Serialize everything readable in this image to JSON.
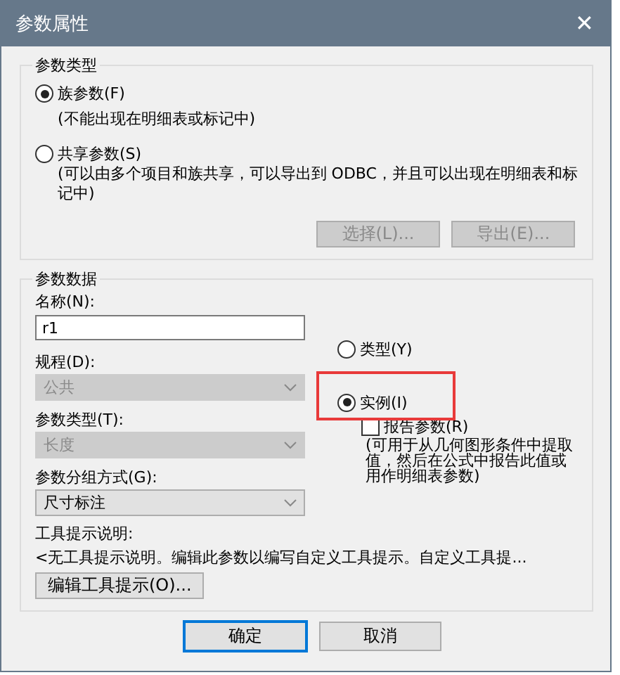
{
  "window": {
    "title": "参数属性",
    "close": "✕"
  },
  "parameter_type": {
    "legend": "参数类型",
    "options": [
      {
        "label": "族参数(F)",
        "note": "(不能出现在明细表或标记中)",
        "selected": true
      },
      {
        "label": "共享参数(S)",
        "note": "(可以由多个项目和族共享，可以导出到 ODBC，并且可以出现在明细表和标记中)",
        "selected": false
      }
    ],
    "buttons": [
      {
        "label": "选择(L)...",
        "disabled": true
      },
      {
        "label": "导出(E)...",
        "disabled": true
      }
    ]
  },
  "parameter_data": {
    "legend": "参数数据",
    "name": {
      "label": "名称(N):",
      "value": "r1"
    },
    "dropdowns": [
      {
        "label": "规程(D):",
        "value": "公共",
        "disabled": true
      },
      {
        "label": "参数类型(T):",
        "value": "长度",
        "disabled": true
      },
      {
        "label": "参数分组方式(G):",
        "value": "尺寸标注",
        "disabled": false
      }
    ],
    "scope": [
      {
        "label": "类型(Y)",
        "selected": false,
        "highlighted": false
      },
      {
        "label": "实例(I)",
        "selected": true,
        "highlighted": true
      }
    ],
    "report": {
      "label": "报告参数(R)",
      "checked": false,
      "note": "(可用于从几何图形条件中提取值，然后在公式中报告此值或用作明细表参数)"
    },
    "tooltip_label": "工具提示说明:",
    "tooltip_text": "<无工具提示说明。编辑此参数以编写自定义工具提示。自定义工具提...",
    "edit_button": "编辑工具提示(O)..."
  },
  "footer_buttons": [
    {
      "label": "确定",
      "default": true
    },
    {
      "label": "取消",
      "default": false
    }
  ]
}
